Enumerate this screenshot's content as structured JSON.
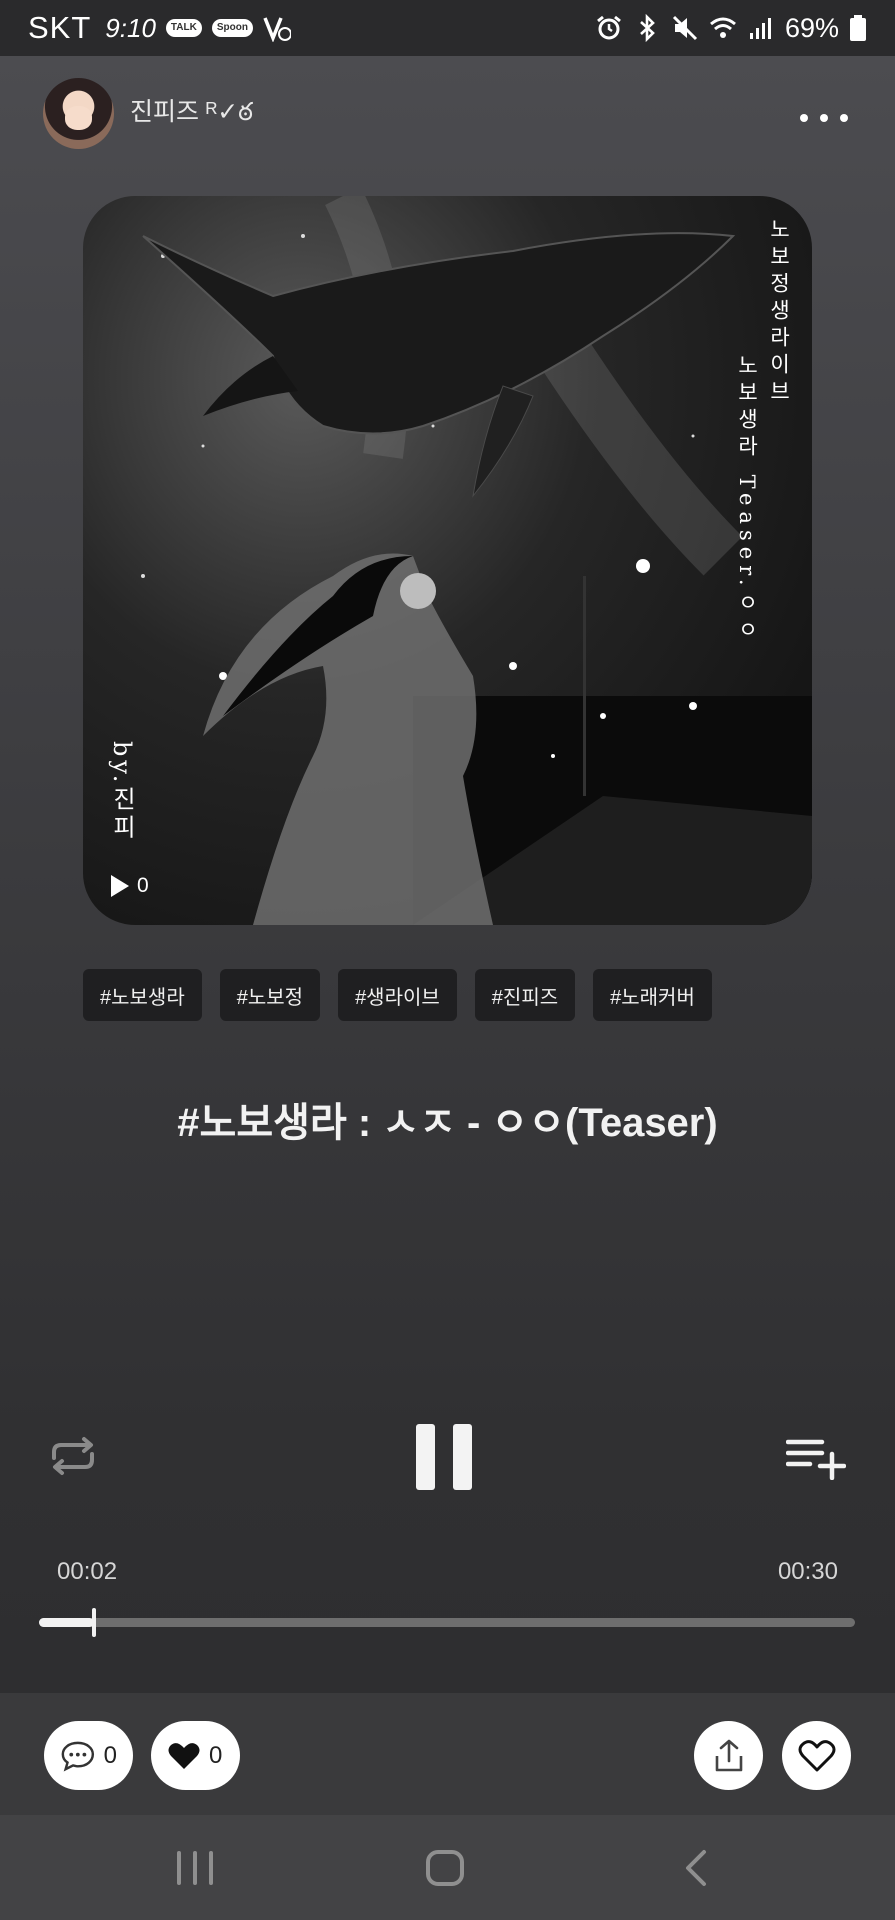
{
  "status_bar": {
    "carrier": "SKT",
    "time": "9:10",
    "notif_talk": "TALK",
    "notif_spoon": "Spoon",
    "battery": "69%",
    "icons": [
      "alarm-icon",
      "bluetooth-icon",
      "mute-icon",
      "wifi-icon",
      "signal-icon",
      "battery-icon"
    ]
  },
  "header": {
    "username": "진피즈 ᴿ✓ఠ"
  },
  "album_art": {
    "vertical_text_1": "노보정생라이브",
    "vertical_text_2": "노보생라 Teaser.ㅇㅇ",
    "vertical_text_3": "by.진피",
    "play_count": "0"
  },
  "tags": [
    "#노보생라",
    "#노보정",
    "#생라이브",
    "#진피즈",
    "#노래커버"
  ],
  "track": {
    "title": "#노보생라 : ㅅㅈ - ㅇㅇ(Teaser)"
  },
  "player": {
    "current_time": "00:02",
    "total_time": "00:30",
    "progress": 0.067
  },
  "actions": {
    "comment_count": "0",
    "like_count": "0"
  }
}
